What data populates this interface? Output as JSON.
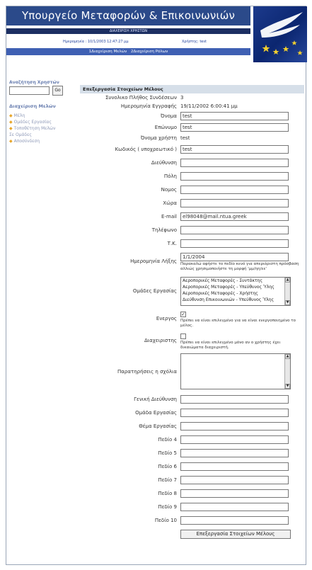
{
  "header": {
    "title": "Υπουργείο Μεταφορών & Επικοινωνιών",
    "subtitle": "ΔΙΑΧΕΙΡΙΣΗ ΧΡΗΣΤΩΝ",
    "date_label": "Ημερομηνία :",
    "date_value": "10/1/2003 12:47:27 μμ",
    "user_label": "Χρήστης:",
    "user_value": "test",
    "nav": [
      "1Διαχείριση Μελών",
      "2Διαχείριση Ρόλων"
    ]
  },
  "sidebar": {
    "search_label": "Αναζήτηση Χρηστών",
    "search_value": "",
    "go_label": "Go",
    "section_title": "Διαχείριση Μελών",
    "items": [
      {
        "label": "Μέλη",
        "bullet": true
      },
      {
        "label": "Ομάδες Εργασίας",
        "bullet": true
      },
      {
        "label": "Τοποθέτηση Μελών",
        "bullet": true
      },
      {
        "label": "Σε Ομάδες",
        "bullet": false
      },
      {
        "label": "Αποσύνδεση",
        "bullet": true
      }
    ]
  },
  "form": {
    "title": "Επεξεργασία Στοιχείων Μέλους",
    "login_count_label": "Συνολικο Πλήθος Συνδέσεων",
    "login_count_value": "3",
    "reg_date_label": "Ημερομηνία Εγγραφής",
    "reg_date_value": "19/11/2002 6:00:41 μμ",
    "first_name_label": "Όνομα",
    "first_name_value": "test",
    "last_name_label": "Επώνυμο",
    "last_name_value": "test",
    "username_label": "Όνομα χρήστη",
    "username_value": "test",
    "password_label": "Κωδικός ( υποχρεωτικό )",
    "password_value": "test",
    "address_label": "Διεύθυνση",
    "city_label": "Πόλη",
    "prefecture_label": "Νομος",
    "country_label": "Χώρα",
    "email_label": "E-mail",
    "email_value": "el98048@mail.ntua.greek",
    "phone_label": "Τηλέφωνο",
    "zip_label": "Τ.Κ.",
    "expiry_label": "Ημερομηνία Λήξης",
    "expiry_value": "1/1/2004",
    "expiry_hint": "Παρακαλώ αφήστε το πεδίο κενό για απεριόριστη πρόσβαση αλλιώς χρησιμοποιήστε τη μορφή 'μμ/ηη/εε'",
    "groups_label": "Ομάδες Εργασίας",
    "groups_options": [
      "Αεροπορικές Μεταφορές - Συντάκτης",
      "Αεροπορικές Μεταφορές - Υπεύθυνος Ύλης",
      "Αεροπορικές Μεταφορές - Χρήστης",
      "Διεύθυνση Επικοινωνιών - Υπεύθυνος Ύλης"
    ],
    "active_label": "Ενεργος",
    "active_checked": true,
    "active_hint": "Πρέπει να είναι επιλεγμένο για να είναι ενεργοποιημένο το μέλος.",
    "admin_label": "Διαχειριστης",
    "admin_checked": false,
    "admin_hint": "Πρέπει να είναι επιλεγμένο μόνο αν ο χρήστης έχει δικαιώματα διαχειριστή.",
    "notes_label": "Παρατηρήσεις η σχόλια",
    "gen_dir_label": "Γενική Διεύθυνση",
    "work_group_label": "Ομάδα Εργασίας",
    "work_subject_label": "Θέμα Εργασίας",
    "field4_label": "Πεδίο 4",
    "field5_label": "Πεδίο 5",
    "field6_label": "Πεδίο 6",
    "field7_label": "Πεδίο 7",
    "field8_label": "Πεδίο 8",
    "field9_label": "Πεδίο 9",
    "field10_label": "Πεδίο 10",
    "submit_label": "Επεξεργασία Στοιχείων Μέλους"
  }
}
